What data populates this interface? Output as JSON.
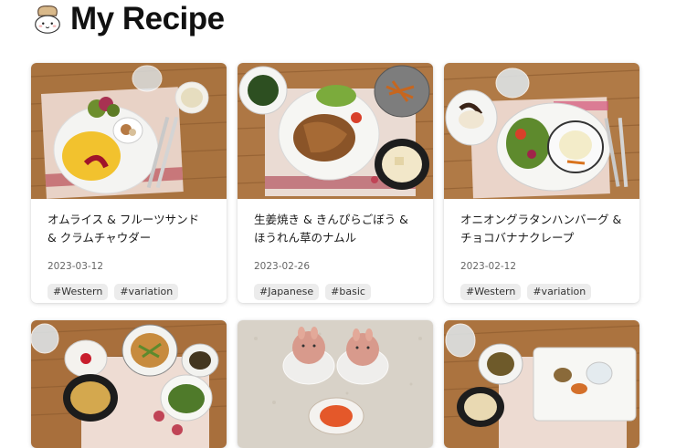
{
  "header": {
    "title": "My Recipe",
    "logo_icon": "chef-bun-icon"
  },
  "recipes": [
    {
      "title": "オムライス & フルーツサンド & クラムチャウダー",
      "date": "2023-03-12",
      "tags": [
        "#Western",
        "#variation"
      ]
    },
    {
      "title": "生姜焼き & きんぴらごぼう & ほうれん草のナムル",
      "date": "2023-02-26",
      "tags": [
        "#Japanese",
        "#basic"
      ]
    },
    {
      "title": "オニオングラタンハンバーグ & チョコバナナクレープ",
      "date": "2023-02-12",
      "tags": [
        "#Western",
        "#variation"
      ]
    }
  ],
  "colors": {
    "wood": "#b07a46",
    "tag_bg": "#ececec",
    "placemat": "#e9d4c8"
  }
}
